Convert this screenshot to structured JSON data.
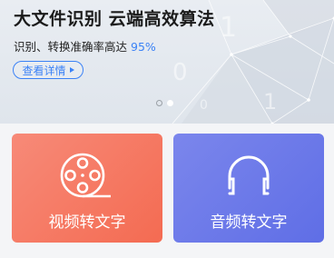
{
  "banner": {
    "title": "大文件识别 云端高效算法",
    "subtitle_text": "识别、转换准确率高达",
    "subtitle_highlight": "95%",
    "detail_button": "查看详情",
    "carousel": {
      "count": 2,
      "active_index": 1
    }
  },
  "cards": {
    "video": {
      "label": "视频转文字",
      "icon": "film-reel-icon"
    },
    "audio": {
      "label": "音频转文字",
      "icon": "headphones-icon"
    }
  },
  "colors": {
    "accent": "#3b82f6",
    "video_card": "#f47a64",
    "audio_card": "#6a78ea"
  }
}
